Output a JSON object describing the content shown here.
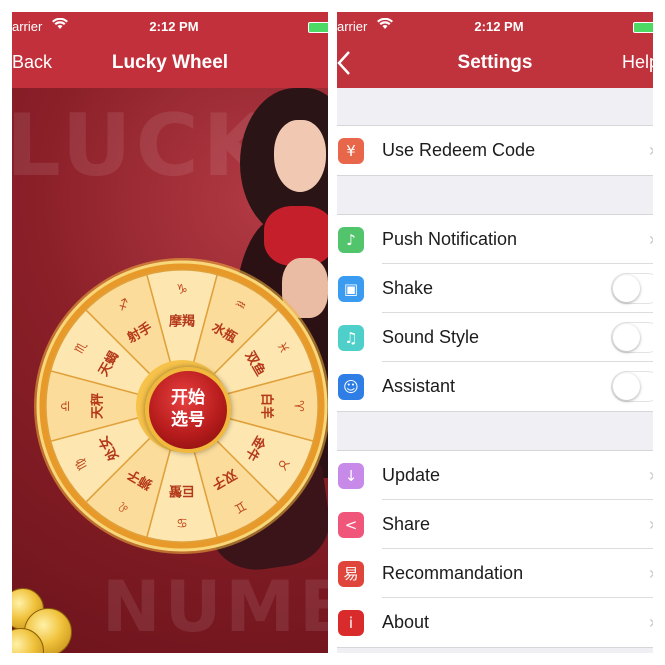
{
  "status_bar": {
    "carrier": "arrier",
    "time": "2:12 PM"
  },
  "left_screen": {
    "nav": {
      "back_label": "Back",
      "title": "Lucky Wheel"
    },
    "background_text": {
      "top": "LUCKY",
      "bottom": "NUMBER"
    },
    "wheel": {
      "start_button": {
        "line1": "开始",
        "line2": "选号"
      },
      "segments": [
        {
          "name": "摩羯",
          "symbol": "♑"
        },
        {
          "name": "水瓶",
          "symbol": "♒"
        },
        {
          "name": "双鱼",
          "symbol": "♓"
        },
        {
          "name": "白羊",
          "symbol": "♈"
        },
        {
          "name": "金牛",
          "symbol": "♉"
        },
        {
          "name": "双子",
          "symbol": "♊"
        },
        {
          "name": "巨蟹",
          "symbol": "♋"
        },
        {
          "name": "狮子",
          "symbol": "♌"
        },
        {
          "name": "处女",
          "symbol": "♍"
        },
        {
          "name": "天秤",
          "symbol": "♎"
        },
        {
          "name": "天蝎",
          "symbol": "♏"
        },
        {
          "name": "射手",
          "symbol": "♐"
        }
      ]
    }
  },
  "right_screen": {
    "nav": {
      "back_icon": "chevron-left",
      "title": "Settings",
      "help_label": "Help"
    },
    "sections": [
      {
        "rows": [
          {
            "id": "redeem",
            "label": "Use Redeem Code",
            "icon": "redeem-icon",
            "icon_glyph": "¥",
            "color": "#e8664a",
            "accessory": "arrow"
          }
        ]
      },
      {
        "rows": [
          {
            "id": "push",
            "label": "Push Notification",
            "icon": "bell-icon",
            "icon_glyph": "♪",
            "color": "#52c46b",
            "accessory": "arrow"
          },
          {
            "id": "shake",
            "label": "Shake",
            "icon": "phone-shake-icon",
            "icon_glyph": "▣",
            "color": "#3a9bf0",
            "accessory": "toggle",
            "on": false
          },
          {
            "id": "sound",
            "label": "Sound Style",
            "icon": "music-note-icon",
            "icon_glyph": "♫",
            "color": "#4fcfc9",
            "accessory": "toggle",
            "on": false
          },
          {
            "id": "assistant",
            "label": "Assistant",
            "icon": "assistant-icon",
            "icon_glyph": "☺",
            "color": "#2f7ee6",
            "accessory": "toggle",
            "on": false
          }
        ]
      },
      {
        "rows": [
          {
            "id": "update",
            "label": "Update",
            "icon": "download-icon",
            "icon_glyph": "↓",
            "color": "#c88ae8",
            "accessory": "arrow"
          },
          {
            "id": "share",
            "label": "Share",
            "icon": "share-icon",
            "icon_glyph": "<",
            "color": "#f0567a",
            "accessory": "arrow"
          },
          {
            "id": "recommend",
            "label": "Recommandation",
            "icon": "recommend-icon",
            "icon_glyph": "易",
            "color": "#e0453c",
            "accessory": "arrow"
          },
          {
            "id": "about",
            "label": "About",
            "icon": "info-icon",
            "icon_glyph": "i",
            "color": "#d92b2b",
            "accessory": "arrow"
          }
        ]
      }
    ]
  }
}
